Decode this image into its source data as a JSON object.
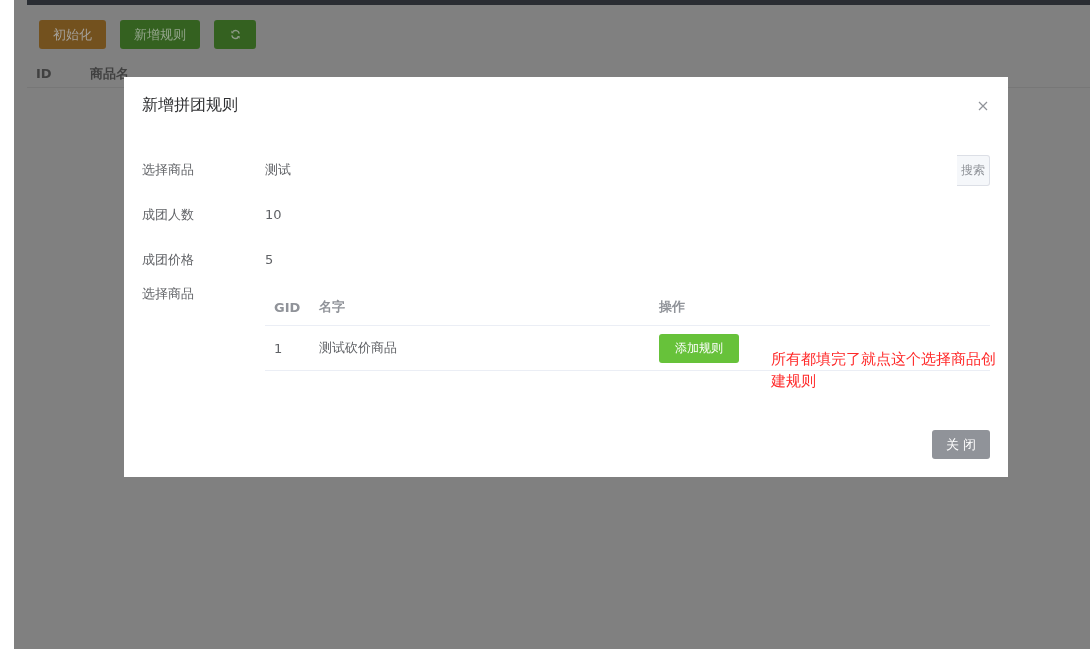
{
  "toolbar": {
    "buttons": [
      {
        "kind": "warning",
        "label": "初始化"
      },
      {
        "kind": "success",
        "label": "新增规则"
      },
      {
        "kind": "refresh"
      }
    ]
  },
  "table": {
    "columns": [
      "ID",
      "商品名"
    ]
  },
  "dialog": {
    "title": "新增拼团规则",
    "fields": [
      {
        "label": "选择商品",
        "value": "测试",
        "search_button": "搜索"
      },
      {
        "label": "成团人数",
        "value": "10"
      },
      {
        "label": "成团价格",
        "value": "5"
      }
    ],
    "goods": {
      "label": "选择商品",
      "columns": [
        "GID",
        "名字",
        "操作"
      ],
      "rows": [
        {
          "gid": "1",
          "name": "测试砍价商品",
          "action": "添加规则"
        }
      ]
    },
    "annotation": "所有都填完了就点这个选择商品创建规则",
    "close_button": "关 闭"
  }
}
